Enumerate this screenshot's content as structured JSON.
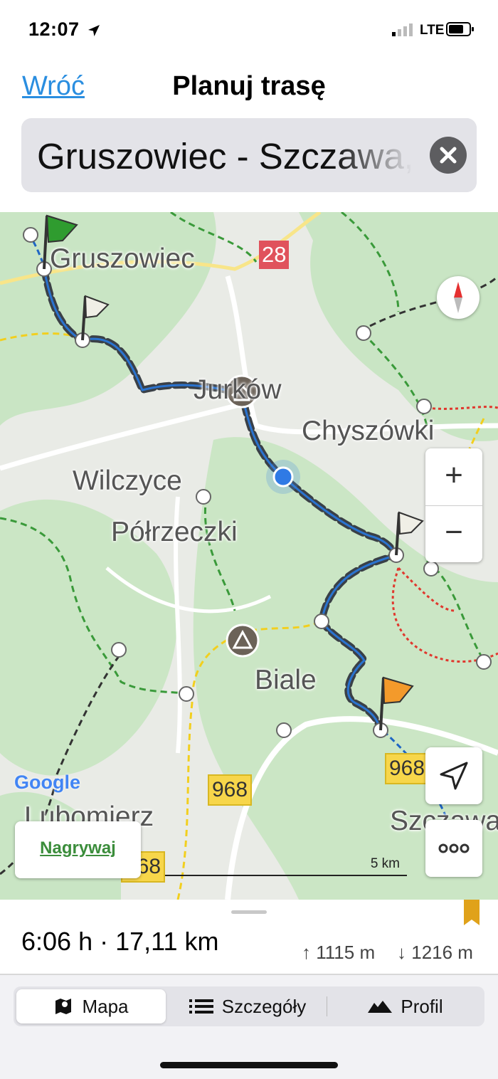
{
  "status_bar": {
    "time": "12:07",
    "network": "LTE"
  },
  "header": {
    "back_label": "Wróć",
    "title": "Planuj trasę"
  },
  "route_field": {
    "value": "Gruszowiec - Szczawa,"
  },
  "map": {
    "place_labels": [
      "Gruszowiec",
      "Jurków",
      "Chyszówki",
      "Wilczyce",
      "Półrzeczki",
      "Biale",
      "Lubomierz",
      "Szczawa"
    ],
    "road_numbers": [
      "28",
      "968",
      "968",
      "968"
    ],
    "provider": "Google",
    "scale_label": "5 km",
    "zoom_in_label": "+",
    "zoom_out_label": "−",
    "record_label": "Nagrywaj",
    "colors": {
      "route": "#3a4047",
      "trail_blue": "#1f66c4",
      "trail_green": "#3a9a3a",
      "trail_yellow": "#f2cf1e",
      "trail_red": "#e0382e",
      "trail_black": "#333333",
      "forest": "#c6e4c1"
    }
  },
  "summary": {
    "time_distance": "6:06 h · 17,11 km",
    "ascent": "1115 m",
    "descent": "1216 m"
  },
  "tabs": [
    {
      "label": "Mapa",
      "icon": "map-icon",
      "selected": true
    },
    {
      "label": "Szczegóły",
      "icon": "list-icon",
      "selected": false
    },
    {
      "label": "Profil",
      "icon": "mountain-icon",
      "selected": false
    }
  ]
}
